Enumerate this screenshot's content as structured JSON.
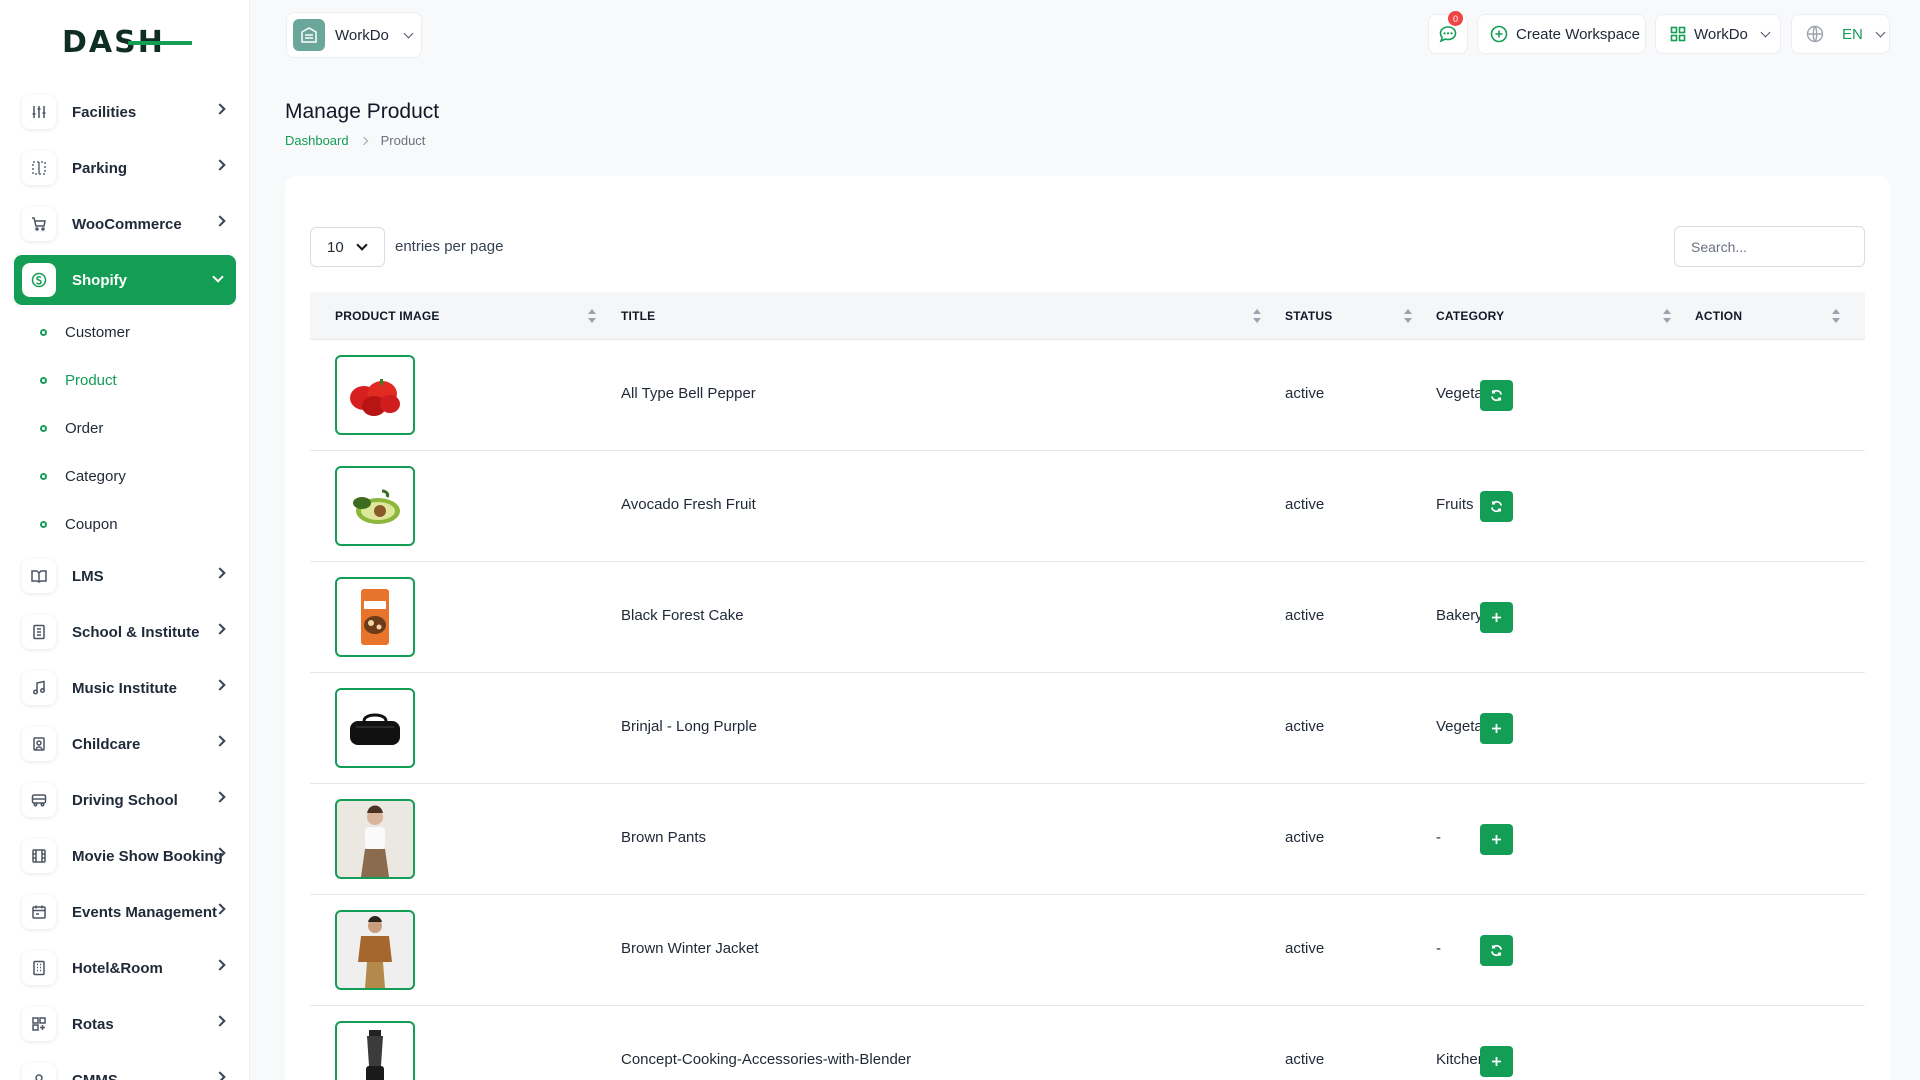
{
  "brand": {
    "logo_text": "DASH",
    "accent": "#139d55"
  },
  "sidebar": {
    "items": [
      {
        "label": "Facilities",
        "icon": "sliders-icon"
      },
      {
        "label": "Parking",
        "icon": "parking-icon"
      },
      {
        "label": "WooCommerce",
        "icon": "cart-icon"
      },
      {
        "label": "Shopify",
        "icon": "shopify-icon",
        "active": true
      },
      {
        "label": "LMS",
        "icon": "book-icon"
      },
      {
        "label": "School & Institute",
        "icon": "building-icon"
      },
      {
        "label": "Music Institute",
        "icon": "music-icon"
      },
      {
        "label": "Childcare",
        "icon": "childcare-icon"
      },
      {
        "label": "Driving School",
        "icon": "bus-icon"
      },
      {
        "label": "Movie Show Booking",
        "icon": "film-icon"
      },
      {
        "label": "Events Management",
        "icon": "calendar-icon"
      },
      {
        "label": "Hotel&Room",
        "icon": "hotel-icon"
      },
      {
        "label": "Rotas",
        "icon": "grid-icon"
      },
      {
        "label": "CMMS",
        "icon": "tool-icon"
      }
    ],
    "shopify_sub": [
      {
        "label": "Customer"
      },
      {
        "label": "Product",
        "current": true
      },
      {
        "label": "Order"
      },
      {
        "label": "Category"
      },
      {
        "label": "Coupon"
      }
    ]
  },
  "header": {
    "workspace": "WorkDo",
    "messages_count": "0",
    "create_workspace": "Create Workspace",
    "user_workspace": "WorkDo",
    "language": "EN"
  },
  "page": {
    "title": "Manage Product",
    "breadcrumb": {
      "home": "Dashboard",
      "current": "Product"
    }
  },
  "table_controls": {
    "per_page_value": "10",
    "per_page_label": "entries per page",
    "search_placeholder": "Search..."
  },
  "table": {
    "columns": [
      "PRODUCT IMAGE",
      "TITLE",
      "STATUS",
      "CATEGORY",
      "ACTION"
    ],
    "rows": [
      {
        "title": "All Type Bell Pepper",
        "status": "active",
        "category": "Vegetables",
        "action": "sync",
        "image": "bell-pepper"
      },
      {
        "title": "Avocado Fresh Fruit",
        "status": "active",
        "category": "Fruits",
        "action": "sync",
        "image": "avocado"
      },
      {
        "title": "Black Forest Cake",
        "status": "active",
        "category": "Bakery",
        "action": "add",
        "image": "cake-bag"
      },
      {
        "title": "Brinjal - Long Purple",
        "status": "active",
        "category": "Vegetables",
        "action": "add",
        "image": "black-bag"
      },
      {
        "title": "Brown Pants",
        "status": "active",
        "category": "-",
        "action": "add",
        "image": "woman-model"
      },
      {
        "title": "Brown Winter Jacket",
        "status": "active",
        "category": "-",
        "action": "sync",
        "image": "jacket-model"
      },
      {
        "title": "Concept-Cooking-Accessories-with-Blender",
        "status": "active",
        "category": "Kitchen",
        "action": "add",
        "image": "blender"
      }
    ]
  }
}
